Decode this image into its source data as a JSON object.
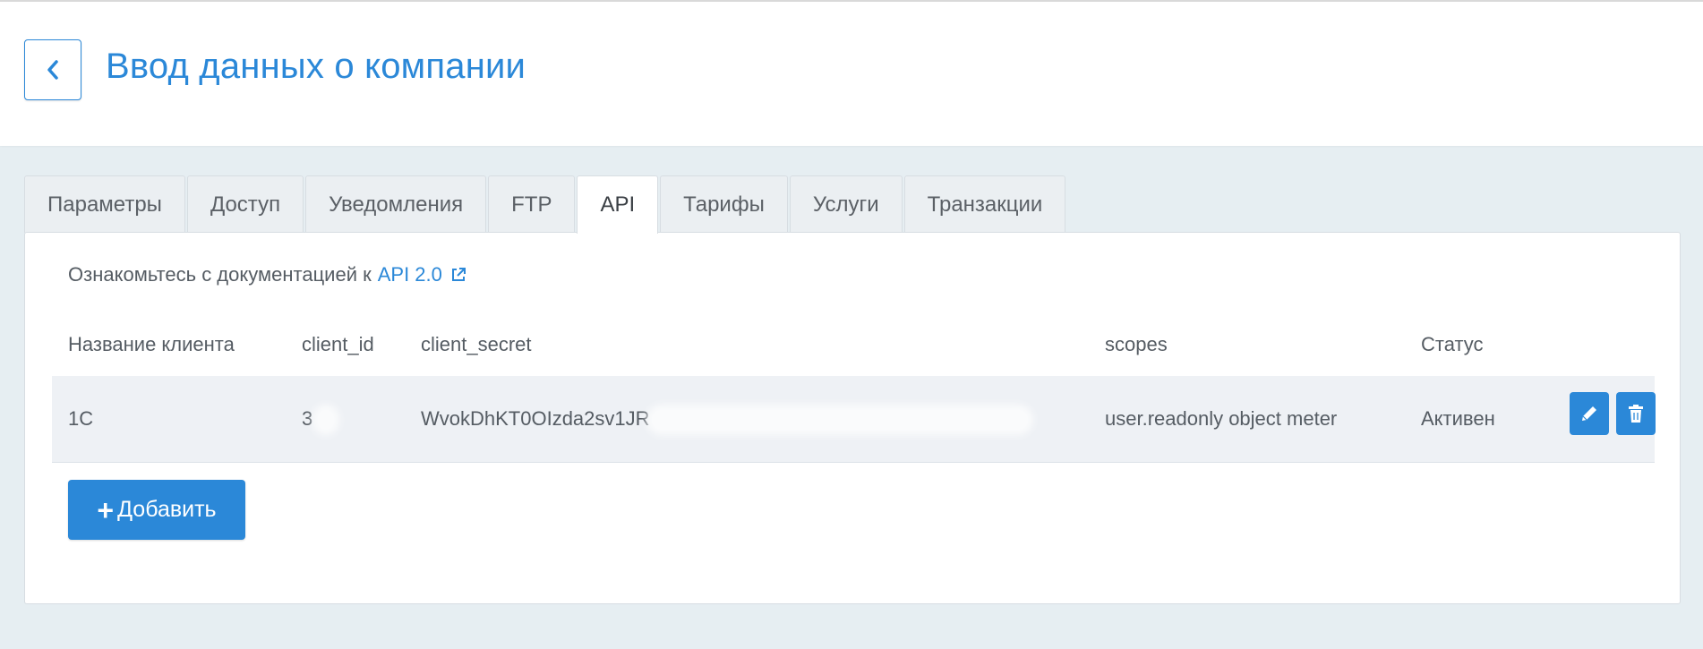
{
  "header": {
    "title": "Ввод данных о компании",
    "back_icon": "chevron-left-icon"
  },
  "tabs": [
    {
      "label": "Параметры",
      "active": false
    },
    {
      "label": "Доступ",
      "active": false
    },
    {
      "label": "Уведомления",
      "active": false
    },
    {
      "label": "FTP",
      "active": false
    },
    {
      "label": "API",
      "active": true
    },
    {
      "label": "Тарифы",
      "active": false
    },
    {
      "label": "Услуги",
      "active": false
    },
    {
      "label": "Транзакции",
      "active": false
    }
  ],
  "api": {
    "doc_text": "Ознакомьтесь с документацией к",
    "doc_link": "API 2.0",
    "doc_link_icon": "external-link-icon"
  },
  "table": {
    "headers": {
      "client_name": "Название клиента",
      "client_id": "client_id",
      "client_secret": "client_secret",
      "scopes": "scopes",
      "status": "Статус"
    },
    "rows": [
      {
        "client_name": "1C",
        "client_id": "3",
        "client_secret": "WvokDhKT0OIzda2sv1JR",
        "scopes": "user.readonly object meter",
        "status": "Активен",
        "edit_icon": "pencil-icon",
        "delete_icon": "trash-icon"
      }
    ]
  },
  "add_button": {
    "label": "Добавить",
    "icon": "plus-icon"
  },
  "colors": {
    "accent": "#2b88d8",
    "background": "#e6eef2",
    "row_bg": "#eef1f5",
    "text": "#555c63"
  }
}
